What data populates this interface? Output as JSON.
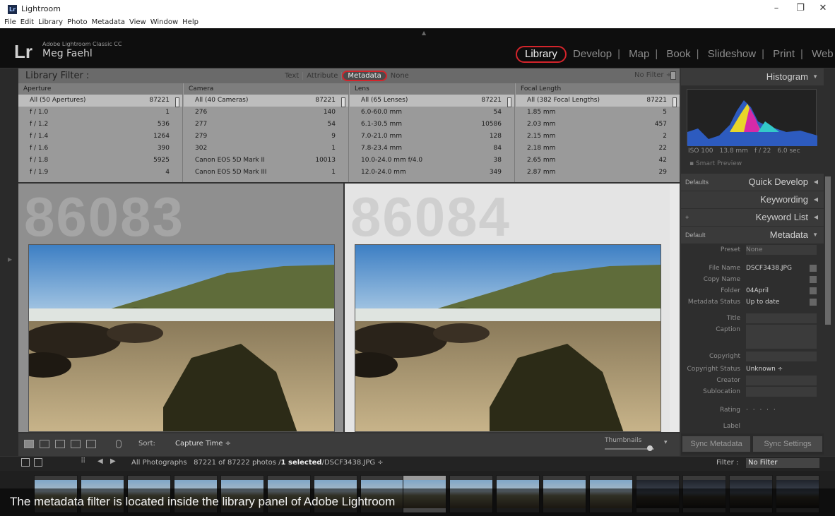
{
  "window": {
    "title": "Lightroom",
    "app_icon": "Lr",
    "minimize": "–",
    "restore": "❐",
    "close": "✕"
  },
  "menu": [
    "File",
    "Edit",
    "Library",
    "Photo",
    "Metadata",
    "View",
    "Window",
    "Help"
  ],
  "identity": {
    "logo": "Lr",
    "product": "Adobe Lightroom Classic CC",
    "user": "Meg Faehl"
  },
  "modules": [
    "Library",
    "Develop",
    "Map",
    "Book",
    "Slideshow",
    "Print",
    "Web"
  ],
  "filter_bar": {
    "title": "Library Filter :",
    "modes": [
      "Text",
      "Attribute",
      "Metadata",
      "None"
    ],
    "active_mode": "Metadata",
    "preset": "No Filter ÷"
  },
  "columns": [
    {
      "header": "Aperture",
      "rows": [
        {
          "label": "All (50 Apertures)",
          "count": "87221"
        },
        {
          "label": "f / 1.0",
          "count": "1"
        },
        {
          "label": "f / 1.2",
          "count": "536"
        },
        {
          "label": "f / 1.4",
          "count": "1264"
        },
        {
          "label": "f / 1.6",
          "count": "390"
        },
        {
          "label": "f / 1.8",
          "count": "5925"
        },
        {
          "label": "f / 1.9",
          "count": "4"
        }
      ]
    },
    {
      "header": "Camera",
      "rows": [
        {
          "label": "All (40 Cameras)",
          "count": "87221"
        },
        {
          "label": "276",
          "count": "140"
        },
        {
          "label": "277",
          "count": "54"
        },
        {
          "label": "279",
          "count": "9"
        },
        {
          "label": "302",
          "count": "1"
        },
        {
          "label": "Canon EOS 5D Mark II",
          "count": "10013"
        },
        {
          "label": "Canon EOS 5D Mark III",
          "count": "1"
        }
      ]
    },
    {
      "header": "Lens",
      "rows": [
        {
          "label": "All (65 Lenses)",
          "count": "87221"
        },
        {
          "label": "6.0-60.0 mm",
          "count": "54"
        },
        {
          "label": "6.1-30.5 mm",
          "count": "10586"
        },
        {
          "label": "7.0-21.0 mm",
          "count": "128"
        },
        {
          "label": "7.8-23.4 mm",
          "count": "84"
        },
        {
          "label": "10.0-24.0 mm f/4.0",
          "count": "38"
        },
        {
          "label": "12.0-24.0 mm",
          "count": "349"
        }
      ]
    },
    {
      "header": "Focal Length",
      "rows": [
        {
          "label": "All (382 Focal Lengths)",
          "count": "87221"
        },
        {
          "label": "1.85 mm",
          "count": "5"
        },
        {
          "label": "2.03 mm",
          "count": "457"
        },
        {
          "label": "2.15 mm",
          "count": "2"
        },
        {
          "label": "2.18 mm",
          "count": "22"
        },
        {
          "label": "2.65 mm",
          "count": "42"
        },
        {
          "label": "2.87 mm",
          "count": "29"
        }
      ]
    }
  ],
  "preview": {
    "left_number": "86083",
    "right_number": "86084"
  },
  "toolbar": {
    "sort_label": "Sort:",
    "sort_value": "Capture Time ÷",
    "thumbnails_label": "Thumbnails"
  },
  "right_panel": {
    "histogram": "Histogram",
    "hist_info": [
      "ISO 100",
      "13.8 mm",
      "f / 22",
      "6.0 sec"
    ],
    "smart_preview": "Smart Preview",
    "quick_develop": {
      "label": "Quick Develop",
      "preset": "Defaults"
    },
    "keywording": "Keywording",
    "keyword_list": {
      "label": "Keyword List",
      "add": "+"
    },
    "metadata": {
      "label": "Metadata",
      "preset": "Default"
    },
    "fields": [
      {
        "label": "Preset",
        "value": "None"
      },
      {
        "label": "File Name",
        "value": "DSCF3438.JPG"
      },
      {
        "label": "Copy Name",
        "value": ""
      },
      {
        "label": "Folder",
        "value": "04April"
      },
      {
        "label": "Metadata Status",
        "value": "Up to date"
      },
      {
        "label": "Title",
        "value": ""
      },
      {
        "label": "Caption",
        "value": ""
      },
      {
        "label": "Copyright",
        "value": ""
      },
      {
        "label": "Copyright Status",
        "value": "Unknown ÷"
      },
      {
        "label": "Creator",
        "value": ""
      },
      {
        "label": "Sublocation",
        "value": ""
      },
      {
        "label": "Rating",
        "value": "· · · · ·"
      },
      {
        "label": "Label",
        "value": ""
      }
    ],
    "sync_metadata": "Sync Metadata",
    "sync_settings": "Sync Settings"
  },
  "filmstrip": {
    "source": "All Photographs",
    "count_text": "87221 of 87222 photos /",
    "selected_text": "1 selected",
    "file_text": "/DSCF3438.JPG ÷",
    "filter_label": "Filter :",
    "filter_value": "No Filter"
  },
  "caption": "The metadata filter is located inside the library panel of Adobe Lightroom",
  "colors": {
    "highlight_ring": "#d4242b",
    "panel_bg": "#333333"
  }
}
